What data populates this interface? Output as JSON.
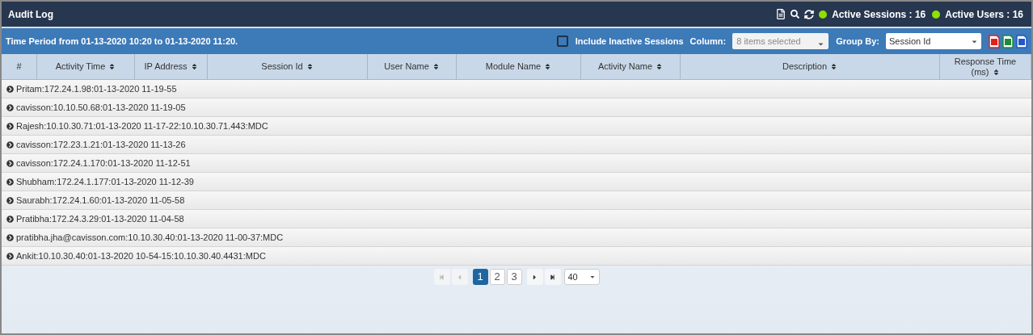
{
  "window": {
    "title": "Audit Log"
  },
  "header_stats": [
    {
      "label": "Active Sessions : 16",
      "color": "#8ee000"
    },
    {
      "label": "Active Users : 16",
      "color": "#8ee000"
    }
  ],
  "toolbar": {
    "time_period": "Time Period from 01-13-2020 10:20 to 01-13-2020 11:20.",
    "include_inactive": {
      "label": "Include Inactive Sessions",
      "checked": false
    },
    "column": {
      "label": "Column:",
      "value": "8 items selected"
    },
    "group_by": {
      "label": "Group By:",
      "value": "Session Id"
    }
  },
  "table": {
    "columns": [
      {
        "label": "#",
        "sortable": false
      },
      {
        "label": "Activity Time",
        "sortable": true
      },
      {
        "label": "IP Address",
        "sortable": true
      },
      {
        "label": "Session Id",
        "sortable": true
      },
      {
        "label": "User Name",
        "sortable": true
      },
      {
        "label": "Module Name",
        "sortable": true
      },
      {
        "label": "Activity Name",
        "sortable": true
      },
      {
        "label": "Description",
        "sortable": true
      },
      {
        "label": "Response Time (ms)",
        "sortable": true
      }
    ],
    "groups": [
      {
        "label": "Pritam:172.24.1.98:01-13-2020 11-19-55",
        "expanded": false
      },
      {
        "label": "cavisson:10.10.50.68:01-13-2020 11-19-05",
        "expanded": false
      },
      {
        "label": "Rajesh:10.10.30.71:01-13-2020 11-17-22:10.10.30.71.443:MDC",
        "expanded": false
      },
      {
        "label": "cavisson:172.23.1.21:01-13-2020 11-13-26",
        "expanded": false
      },
      {
        "label": "cavisson:172.24.1.170:01-13-2020 11-12-51",
        "expanded": false
      },
      {
        "label": "Shubham:172.24.1.177:01-13-2020 11-12-39",
        "expanded": false
      },
      {
        "label": "Saurabh:172.24.1.60:01-13-2020 11-05-58",
        "expanded": false
      },
      {
        "label": "Pratibha:172.24.3.29:01-13-2020 11-04-58",
        "expanded": false
      },
      {
        "label": "pratibha.jha@cavisson.com:10.10.30.40:01-13-2020 11-00-37:MDC",
        "expanded": false
      },
      {
        "label": "Ankit:10.10.30.40:01-13-2020 10-54-15:10.10.30.40.4431:MDC",
        "expanded": false
      }
    ]
  },
  "pagination": {
    "first_disabled": true,
    "prev_disabled": true,
    "next_disabled": false,
    "last_disabled": false,
    "pages": [
      {
        "label": "1",
        "selected": true
      },
      {
        "label": "2",
        "selected": false
      },
      {
        "label": "3",
        "selected": false
      }
    ],
    "page_size": "40"
  }
}
